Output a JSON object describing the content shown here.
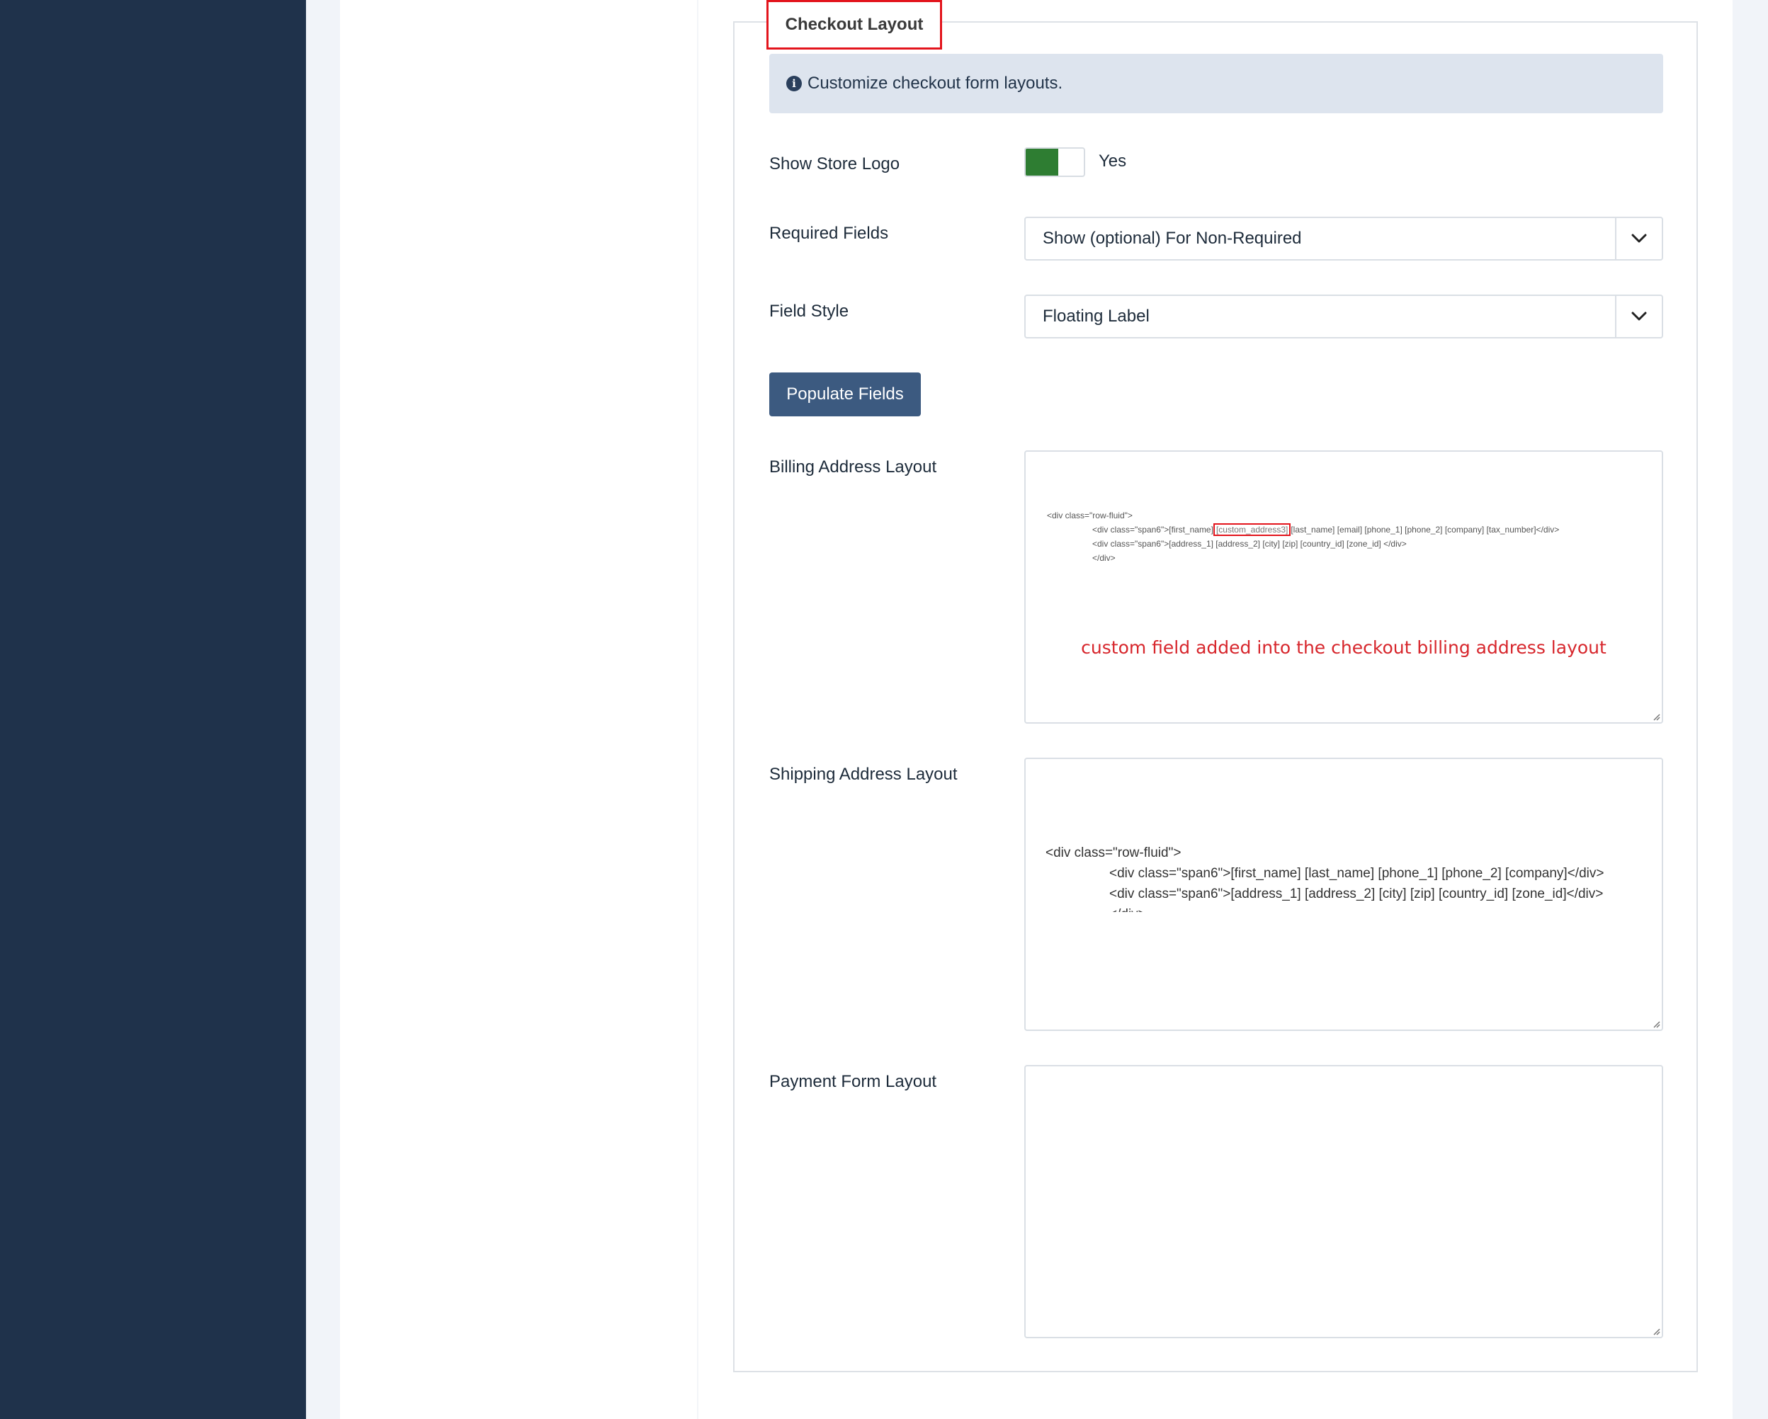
{
  "fieldset": {
    "legend": "Checkout Layout"
  },
  "info": {
    "text": "Customize checkout form layouts.",
    "icon": "info-circle-icon"
  },
  "fields": {
    "show_store_logo": {
      "label": "Show Store Logo",
      "value": "Yes",
      "checked": true,
      "on_color": "#2e7d32"
    },
    "required_fields": {
      "label": "Required Fields",
      "selected": "Show (optional) For Non-Required"
    },
    "field_style": {
      "label": "Field Style",
      "selected": "Floating Label"
    },
    "populate_button": "Populate Fields",
    "billing": {
      "label": "Billing Address Layout",
      "line1": "<div class=\"row-fluid\">",
      "line2_pre": "<div class=\"span6\">[first_name]",
      "line2_highlight": "[custom_address3]",
      "line2_post": "[last_name] [email] [phone_1] [phone_2] [company] [tax_number]</div>",
      "line3": "<div class=\"span6\">[address_1] [address_2] [city] [zip] [country_id] [zone_id] </div>",
      "line4": "</div>",
      "annotation": "custom field added into the checkout billing address layout",
      "annotation_color": "#d7262c"
    },
    "shipping": {
      "label": "Shipping Address Layout",
      "line1": "<div class=\"row-fluid\">",
      "line2": "<div class=\"span6\">[first_name] [last_name] [phone_1] [phone_2] [company]</div>",
      "line3": "<div class=\"span6\">[address_1] [address_2] [city] [zip] [country_id] [zone_id]</div>",
      "line4": "</div>"
    },
    "payment": {
      "label": "Payment Form Layout",
      "value": ""
    }
  },
  "colors": {
    "sidebar": "#1f324b",
    "primary_button": "#3c5a80",
    "highlight_border": "#e3141c"
  }
}
